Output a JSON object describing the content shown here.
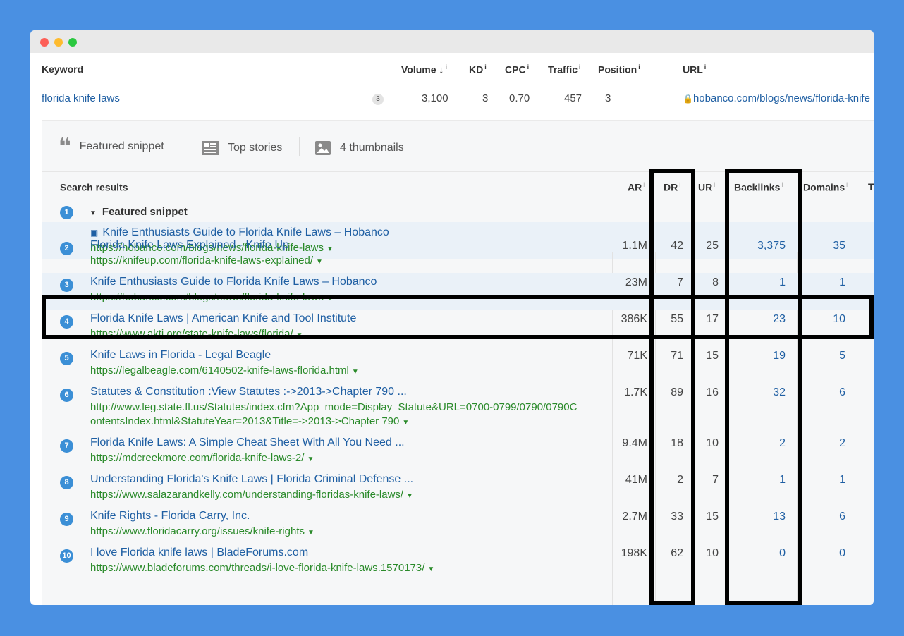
{
  "keyword_table": {
    "headers": {
      "keyword": "Keyword",
      "volume": "Volume",
      "kd": "KD",
      "cpc": "CPC",
      "traffic": "Traffic",
      "position": "Position",
      "url": "URL"
    },
    "row": {
      "keyword": "florida knife laws",
      "serp_count": "3",
      "volume": "3,100",
      "kd": "3",
      "cpc": "0.70",
      "traffic": "457",
      "position": "3",
      "url": "hobanco.com/blogs/news/florida-knife"
    }
  },
  "serp_features": [
    {
      "label": "Featured snippet",
      "icon": "quote-icon"
    },
    {
      "label": "Top stories",
      "icon": "newspaper-icon"
    },
    {
      "label": "4 thumbnails",
      "icon": "image-icon"
    }
  ],
  "results_headers": {
    "search_results": "Search results",
    "ar": "AR",
    "dr": "DR",
    "ur": "UR",
    "backlinks": "Backlinks",
    "domains": "Domains",
    "t": "T"
  },
  "featured": {
    "num": "1",
    "label": "Featured snippet",
    "title": "Knife Enthusiasts Guide to Florida Knife Laws – Hobanco",
    "url": "https://hobanco.com/blogs/news/florida-knife-laws"
  },
  "results": [
    {
      "num": "2",
      "title": "Florida Knife Laws Explained - Knife Up",
      "url": "https://knifeup.com/florida-knife-laws-explained/",
      "ar": "1.1M",
      "dr": "42",
      "ur": "25",
      "backlinks": "3,375",
      "domains": "35"
    },
    {
      "num": "3",
      "title": "Knife Enthusiasts Guide to Florida Knife Laws – Hobanco",
      "url": "https://hobanco.com/blogs/news/florida-knife-laws",
      "ar": "23M",
      "dr": "7",
      "ur": "8",
      "backlinks": "1",
      "domains": "1"
    },
    {
      "num": "4",
      "title": "Florida Knife Laws | American Knife and Tool Institute",
      "url": "https://www.akti.org/state-knife-laws/florida/",
      "ar": "386K",
      "dr": "55",
      "ur": "17",
      "backlinks": "23",
      "domains": "10"
    },
    {
      "num": "5",
      "title": "Knife Laws in Florida - Legal Beagle",
      "url": "https://legalbeagle.com/6140502-knife-laws-florida.html",
      "ar": "71K",
      "dr": "71",
      "ur": "15",
      "backlinks": "19",
      "domains": "5"
    },
    {
      "num": "6",
      "title": "Statutes & Constitution :View Statutes :->2013->Chapter 790 ...",
      "url": "http://www.leg.state.fl.us/Statutes/index.cfm?App_mode=Display_Statute&URL=0700-0799/0790/0790C",
      "url2": "ontentsIndex.html&StatuteYear=2013&Title=->2013->Chapter 790",
      "ar": "1.7K",
      "dr": "89",
      "ur": "16",
      "backlinks": "32",
      "domains": "6"
    },
    {
      "num": "7",
      "title": "Florida Knife Laws: A Simple Cheat Sheet With All You Need ...",
      "url": "https://mdcreekmore.com/florida-knife-laws-2/",
      "ar": "9.4M",
      "dr": "18",
      "ur": "10",
      "backlinks": "2",
      "domains": "2"
    },
    {
      "num": "8",
      "title": "Understanding Florida's Knife Laws | Florida Criminal Defense ...",
      "url": "https://www.salazarandkelly.com/understanding-floridas-knife-laws/",
      "ar": "41M",
      "dr": "2",
      "ur": "7",
      "backlinks": "1",
      "domains": "1"
    },
    {
      "num": "9",
      "title": "Knife Rights - Florida Carry, Inc.",
      "url": "https://www.floridacarry.org/issues/knife-rights",
      "ar": "2.7M",
      "dr": "33",
      "ur": "15",
      "backlinks": "13",
      "domains": "6"
    },
    {
      "num": "10",
      "title": "I love Florida knife laws | BladeForums.com",
      "url": "https://www.bladeforums.com/threads/i-love-florida-knife-laws.1570173/",
      "ar": "198K",
      "dr": "62",
      "ur": "10",
      "backlinks": "0",
      "domains": "0"
    }
  ],
  "colors": {
    "background": "#4a90e2",
    "link": "#1f5fa3",
    "url_green": "#2a8a2a",
    "badge": "#3b8fd6",
    "highlight": "#eaf1f8"
  }
}
